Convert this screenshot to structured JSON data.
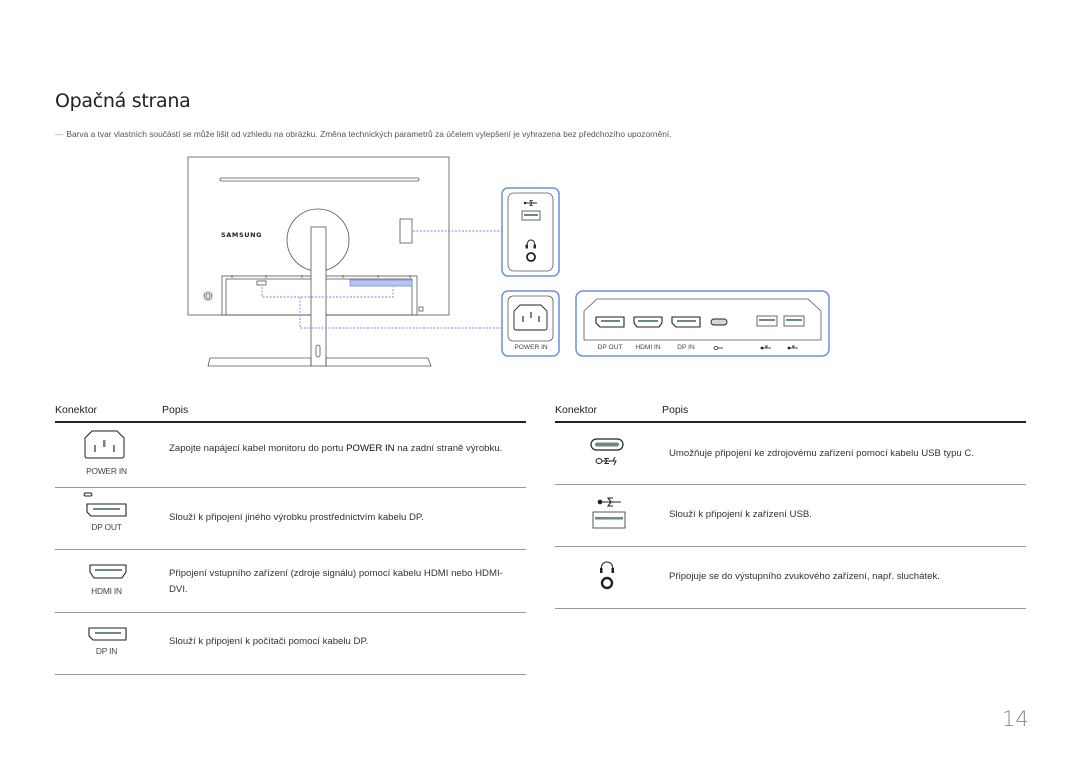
{
  "page": {
    "title": "Opačná strana",
    "note_mark": "―",
    "note": "Barva a tvar vlastních součástí se může lišit od vzhledu na obrázku. Změna technických parametrů za účelem vylepšení je vyhrazena bez předchozího upozornění.",
    "page_number": "14"
  },
  "diagram": {
    "brand": "SAMSUNG",
    "highlight_color": "#6b8fe0",
    "side_panel_ports": [
      "usb-a",
      "headphone"
    ],
    "power_label": "POWER IN",
    "bottom_ports": [
      {
        "label": "DP OUT",
        "type": "displayport"
      },
      {
        "label": "HDMI IN",
        "type": "hdmi"
      },
      {
        "label": "DP IN",
        "type": "displayport"
      },
      {
        "label": "",
        "type": "usb-c",
        "icon": "usb-c-power-icon"
      },
      {
        "label": "",
        "type": "usb-a",
        "icon": "usb-icon"
      },
      {
        "label": "",
        "type": "usb-a",
        "icon": "usb-icon"
      }
    ]
  },
  "tables": {
    "header": {
      "connector": "Konektor",
      "description": "Popis"
    },
    "left": [
      {
        "label": "POWER IN",
        "icon": "power-in-icon",
        "text_pre": "Zapojte napájecí kabel monitoru do portu ",
        "text_bold": "POWER IN",
        "text_post": " na zadní straně výrobku."
      },
      {
        "label": "DP OUT",
        "icon": "dp-out-icon",
        "text": "Slouží k připojení jiného výrobku prostřednictvím kabelu DP."
      },
      {
        "label": "HDMI IN",
        "icon": "hdmi-icon",
        "text": "Připojení vstupního zařízení (zdroje signálu) pomocí kabelu HDMI nebo HDMI-DVI."
      },
      {
        "label": "DP IN",
        "icon": "dp-in-icon",
        "text": "Slouží k připojení k počítači pomocí kabelu DP."
      }
    ],
    "right": [
      {
        "label": "",
        "icon": "usb-c-icon",
        "text": "Umožňuje připojení ke zdrojovému zařízení pomocí kabelu USB typu C."
      },
      {
        "label": "",
        "icon": "usb-a-icon",
        "text": "Slouží k připojení k zařízení USB."
      },
      {
        "label": "",
        "icon": "headphone-icon",
        "text": "Připojuje se do výstupního zvukového zařízení, např. sluchátek."
      }
    ]
  }
}
